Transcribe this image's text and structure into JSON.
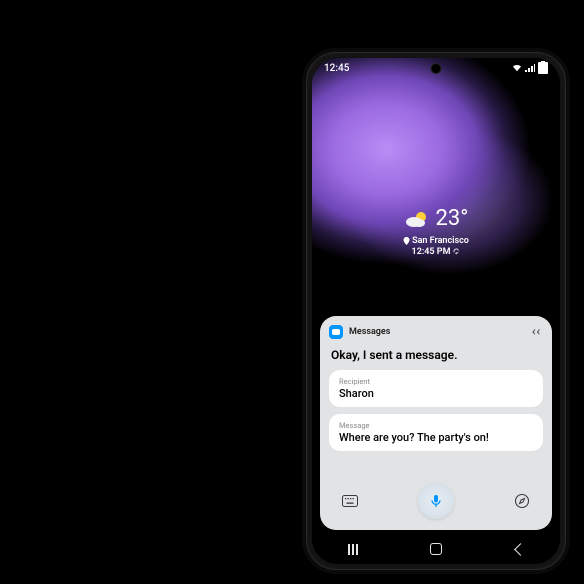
{
  "statusbar": {
    "time": "12:45"
  },
  "weather": {
    "temperature": "23°",
    "location": "San Francisco",
    "clock": "12:45 PM"
  },
  "bixby": {
    "app_name": "Messages",
    "response": "Okay, I sent a message.",
    "recipient_label": "Recipient",
    "recipient_value": "Sharon",
    "message_label": "Message",
    "message_value": "Where are you? The party's on!"
  }
}
